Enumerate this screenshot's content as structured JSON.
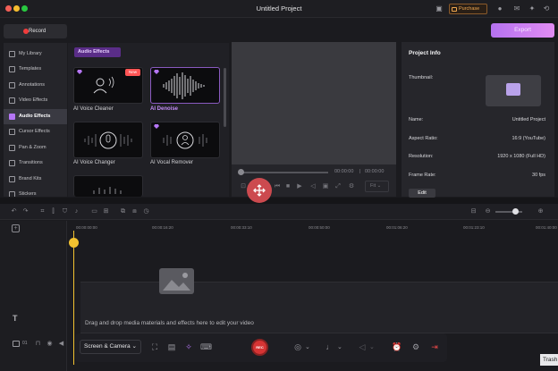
{
  "window": {
    "title": "Untitled Project",
    "purchase_label": "Purchase"
  },
  "toolbar": {
    "record_label": "Record",
    "export_label": "Export"
  },
  "sidebar": {
    "items": [
      {
        "label": "My Library"
      },
      {
        "label": "Templates"
      },
      {
        "label": "Annotations"
      },
      {
        "label": "Video Effects"
      },
      {
        "label": "Audio Effects"
      },
      {
        "label": "Cursor Effects"
      },
      {
        "label": "Pan & Zoom"
      },
      {
        "label": "Transitions"
      },
      {
        "label": "Brand Kits"
      },
      {
        "label": "Stickers"
      }
    ],
    "active_index": 4
  },
  "effects": {
    "section_label": "Audio Effects",
    "new_badge": "New",
    "cards": [
      {
        "label": "AI Voice Cleaner",
        "icon": "person-voice-icon"
      },
      {
        "label": "AI Denoise",
        "icon": "waveform-icon"
      },
      {
        "label": "AI Voice Changer",
        "icon": "microphone-icon"
      },
      {
        "label": "AI Vocal Remover",
        "icon": "person-voice-icon"
      }
    ]
  },
  "player": {
    "current_time": "00:00:00",
    "total_time": "00:00:00",
    "fit_label": "Fit"
  },
  "project_info": {
    "heading": "Project Info",
    "thumbnail_label": "Thumbnail:",
    "rows": [
      {
        "key": "Name:",
        "value": "Untitled Project"
      },
      {
        "key": "Aspect Ratio:",
        "value": "16:9 (YouTube)"
      },
      {
        "key": "Resolution:",
        "value": "1920 x 1080 (Full HD)"
      },
      {
        "key": "Frame Rate:",
        "value": "30 fps"
      }
    ],
    "edit_label": "Edit"
  },
  "timeline": {
    "ruler_ticks": [
      "00:00:00:00",
      "00:00:16:20",
      "00:00:33:10",
      "00:00:50:00",
      "00:01:06:20",
      "00:01:23:10",
      "00:01:40:00"
    ],
    "drop_hint": "Drag and drop media materials and effects here to edit your video",
    "track_count": "01"
  },
  "bottom_bar": {
    "screen_select": "Screen & Camera",
    "rec_label": "REC"
  },
  "trash_label": "Trash",
  "colors": {
    "accent": "#b576f5",
    "record": "#d63434",
    "playhead": "#f2c230",
    "export_gradient_start": "#b572f0",
    "export_gradient_end": "#e18cf2"
  }
}
